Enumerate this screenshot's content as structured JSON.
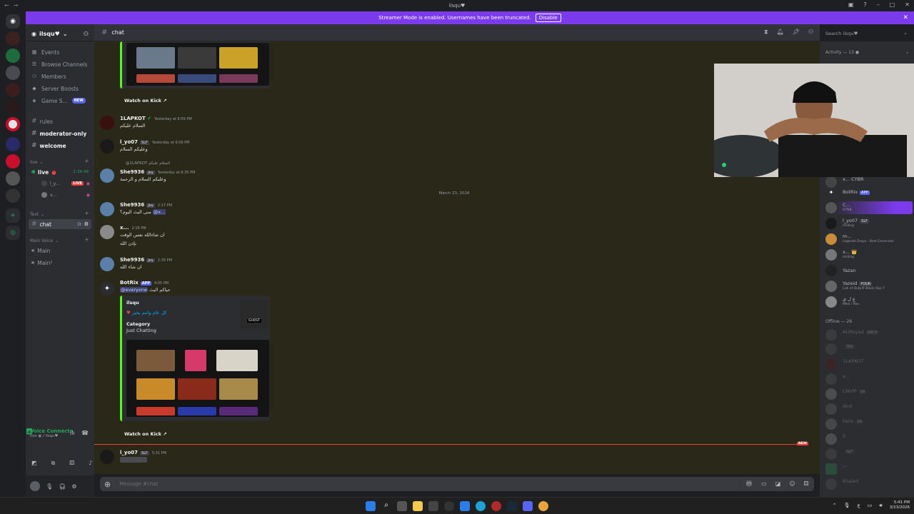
{
  "window": {
    "title": "ilsqu♥"
  },
  "banner": {
    "text": "Streamer Mode is enabled. Usernames have been truncated.",
    "button": "Disable"
  },
  "server": {
    "name": "ilsqu♥"
  },
  "sidebar": {
    "nav": [
      {
        "label": "Events",
        "icon": "calendar-icon"
      },
      {
        "label": "Browse Channels",
        "icon": "browse-icon"
      },
      {
        "label": "Members",
        "icon": "members-icon"
      },
      {
        "label": "Server Boosts",
        "icon": "boost-icon"
      },
      {
        "label": "Game S...",
        "icon": "game-icon",
        "badge": "NEW"
      }
    ],
    "channels_top": [
      {
        "name": "rules",
        "bright": false
      },
      {
        "name": "moderator-only",
        "bright": true
      },
      {
        "name": "welcome",
        "bright": true
      }
    ],
    "live_category": "live",
    "live_channel": {
      "name": "live",
      "timer": "1:36:49"
    },
    "live_users": [
      {
        "name": "l_y...",
        "badge": "LIVE"
      },
      {
        "name": "x..."
      }
    ],
    "text_category": "Text",
    "text_channel": "chat",
    "voice_category": "Main Voice",
    "voice_channels": [
      "Main",
      "Main²"
    ]
  },
  "voice_panel": {
    "status": "Voice Connecte",
    "sub": "live ◉ / ilsqu♥"
  },
  "chat": {
    "channel": "chat",
    "watch_label": "Watch on Kick",
    "day_divider": "March 23, 2026",
    "new_label": "NEW",
    "messages": [
      {
        "author": "1LAPKOT",
        "time": "Yesterday at 6:09 PM",
        "text": "السلام عليكم"
      },
      {
        "author": "l_yo07",
        "tag": "SLF",
        "time": "Yesterday at 6:09 PM",
        "text": "وعليكم السلام"
      },
      {
        "reply": "@1LAPKOT السلام عليكم",
        "author": "She9936",
        "tag": "Jey",
        "time": "Yesterday at 8:35 PM",
        "text": "وعليكم السلام و الرحمة"
      },
      {
        "author": "She9936",
        "tag": "Jey",
        "time": "2:17 PM",
        "text": "متى البث اليوم؟",
        "mention": "@x..."
      },
      {
        "author": "x...",
        "time": "2:18 PM",
        "text": "ان شاءالله نفس الوقت",
        "text2": "بإذن الله"
      },
      {
        "author": "She9936",
        "tag": "Jey",
        "time": "2:35 PM",
        "text": "ان شاء الله"
      },
      {
        "author": "BotRix",
        "tag": "APP",
        "time": "4:05 PM",
        "mention": "@everyone",
        "text": "حياكم البث"
      },
      {
        "author": "l_yo07",
        "tag": "SLF",
        "time": "5:31 PM",
        "text": "QT CHILLE"
      }
    ],
    "embed": {
      "author": "ilsqu",
      "title": "كل عام وانتم بخير",
      "field_name": "Category",
      "field_value": "Just Chatting",
      "thumb_label": "GHOST"
    }
  },
  "composer": {
    "placeholder": "Message #chat"
  },
  "search": {
    "placeholder": "Search ilsqu♥"
  },
  "members": {
    "activity": "Activity — 13",
    "online": [
      {
        "name": "x... CYBR",
        "status": ""
      },
      {
        "name": "BotRix",
        "tag": "APP",
        "status": ""
      },
      {
        "name": "C...",
        "status": "GTNB"
      },
      {
        "name": "l_yo07",
        "tag": "SLF",
        "status": "chilling"
      },
      {
        "name": "m...",
        "status": "Legends Drops : Best Generator"
      },
      {
        "name": "x... 👑",
        "status": "chilling"
      },
      {
        "name": "Yazan",
        "status": ""
      },
      {
        "name": "Yazeid",
        "tag": "FOUR",
        "status": "Call of Duty® Black Ops 7"
      },
      {
        "name": "ﻉ ﻝ ﻱ",
        "status": "Mike / Reo"
      }
    ],
    "offline_header": "Offline — 26",
    "offline": [
      {
        "name": "ALMoyad",
        "tag": "ARCH"
      },
      {
        "name": "",
        "tag": "TEK"
      },
      {
        "name": "1LAPKOT"
      },
      {
        "name": "a..."
      },
      {
        "name": "CNVIP",
        "tag": "SA"
      },
      {
        "name": "doxl"
      },
      {
        "name": "Farix",
        "tag": "SA"
      },
      {
        "name": "fr"
      },
      {
        "name": "",
        "tag": "SLF"
      },
      {
        "name": "—"
      },
      {
        "name": "Khaled"
      }
    ]
  },
  "taskbar": {
    "time": "5:41 PM",
    "date": "3/23/2026"
  }
}
